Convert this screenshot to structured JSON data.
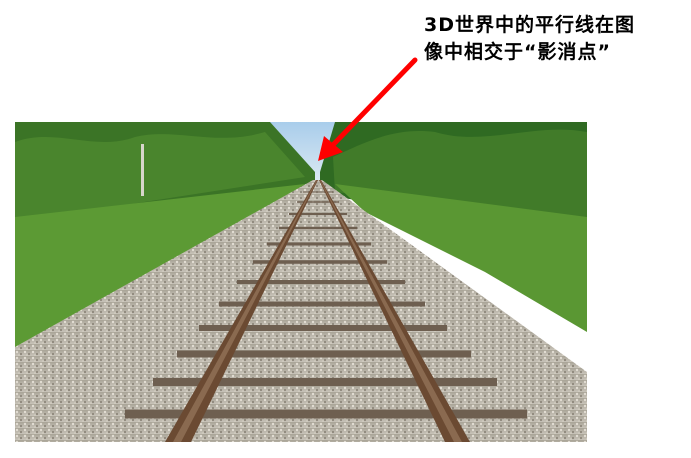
{
  "annotation": {
    "line1": "3D世界中的平行线在图",
    "line2": "像中相交于“影消点”"
  },
  "photo": {
    "subject": "railway tracks converging toward the horizon",
    "colors": {
      "sky": "#bcd8ef",
      "foliage": "#3f7d2a",
      "grass": "#5c9a34",
      "gravel": "#b9b3a8",
      "rail": "#6b4a32",
      "ties": "#7a6a5a"
    }
  },
  "arrow": {
    "color": "#ff0000"
  }
}
